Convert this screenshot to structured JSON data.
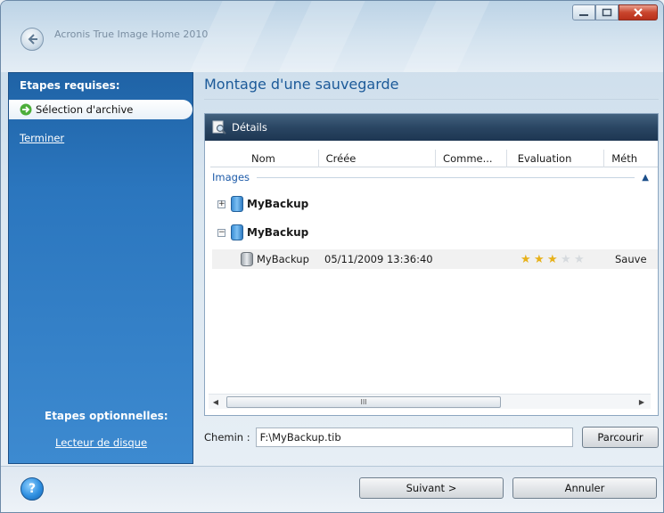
{
  "window": {
    "app_title": "Acronis True Image Home 2010"
  },
  "sidebar": {
    "required_heading": "Etapes requises:",
    "steps": [
      {
        "label": "Sélection d'archive",
        "active": true
      },
      {
        "label": "Terminer",
        "active": false
      }
    ],
    "optional_heading": "Etapes optionnelles:",
    "optional_steps": [
      {
        "label": "Lecteur de disque"
      }
    ]
  },
  "main": {
    "title": "Montage d'une sauvegarde",
    "details_label": "Détails",
    "columns": [
      "Nom",
      "Créée",
      "Comme...",
      "Evaluation",
      "Méth"
    ],
    "group_label": "Images",
    "tree": [
      {
        "label": "MyBackup",
        "expander": "+"
      },
      {
        "label": "MyBackup",
        "expander": "−"
      }
    ],
    "selected_item": {
      "name": "MyBackup",
      "created": "05/11/2009 13:36:40",
      "comment": "",
      "rating": 3,
      "rating_max": 5,
      "method": "Sauve"
    },
    "scroll_thumb_glyph": "III",
    "path_label": "Chemin :",
    "path_value": "F:\\MyBackup.tib",
    "browse_label": "Parcourir"
  },
  "footer": {
    "help_glyph": "?",
    "next_label": "Suivant >",
    "cancel_label": "Annuler"
  }
}
